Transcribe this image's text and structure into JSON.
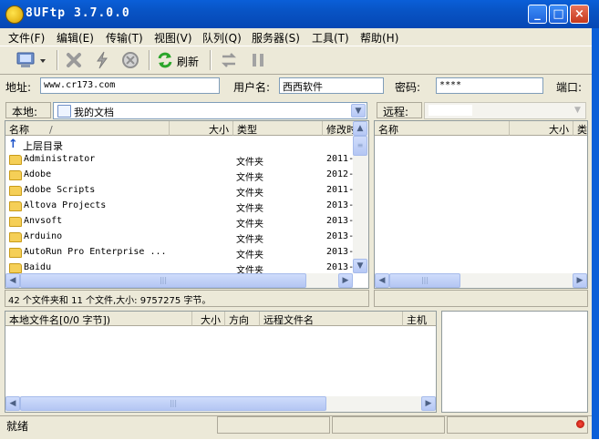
{
  "window": {
    "title": "8UFtp 3.7.0.0"
  },
  "menu": [
    "文件(F)",
    "编辑(E)",
    "传输(T)",
    "视图(V)",
    "队列(Q)",
    "服务器(S)",
    "工具(T)",
    "帮助(H)"
  ],
  "toolbar": {
    "refresh_label": "刷新"
  },
  "address": {
    "addr_label": "地址:",
    "addr_value": "www.cr173.com",
    "user_label": "用户名:",
    "user_value": "西西软件",
    "pass_label": "密码:",
    "pass_value": "****",
    "port_label": "端口:"
  },
  "local": {
    "label": "本地:",
    "path": "我的文档",
    "columns": {
      "name": "名称",
      "sort": "/",
      "size": "大小",
      "type": "类型",
      "modified": "修改时"
    },
    "parent": "上层目录",
    "rows": [
      {
        "name": "Administrator",
        "type": "文件夹",
        "date": "2011-"
      },
      {
        "name": "Adobe",
        "type": "文件夹",
        "date": "2012-"
      },
      {
        "name": "Adobe Scripts",
        "type": "文件夹",
        "date": "2011-"
      },
      {
        "name": "Altova Projects",
        "type": "文件夹",
        "date": "2013-"
      },
      {
        "name": "Anvsoft",
        "type": "文件夹",
        "date": "2013-"
      },
      {
        "name": "Arduino",
        "type": "文件夹",
        "date": "2013-"
      },
      {
        "name": "AutoRun Pro Enterprise ...",
        "type": "文件夹",
        "date": "2013-"
      },
      {
        "name": "Baidu",
        "type": "文件夹",
        "date": "2013-"
      }
    ],
    "status": "42 个文件夹和 11 个文件,大小: 9757275 字节。"
  },
  "remote": {
    "label": "远程:",
    "columns": {
      "name": "名称",
      "size": "大小",
      "type": "类"
    }
  },
  "queue": {
    "columns": {
      "local": "本地文件名[0/0 字节])",
      "size": "大小",
      "dir": "方向",
      "remote": "远程文件名",
      "host": "主机"
    }
  },
  "statusbar": {
    "text": "就绪"
  }
}
